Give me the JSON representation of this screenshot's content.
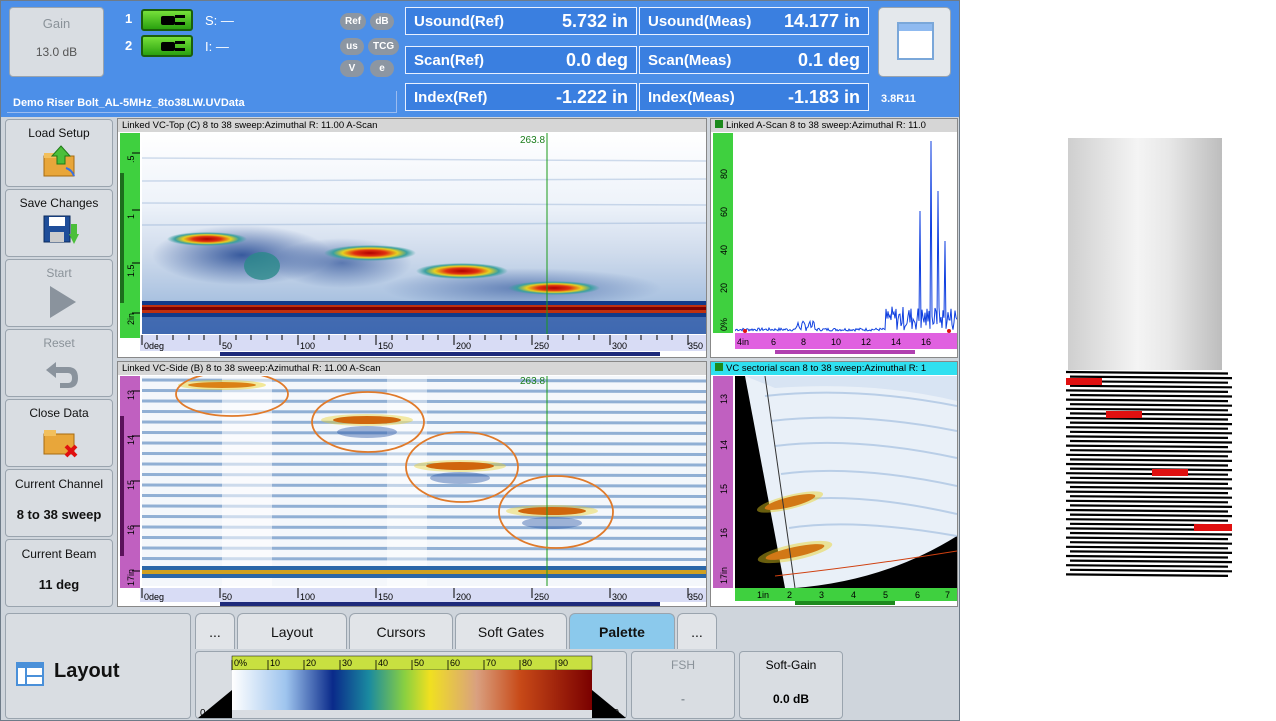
{
  "header": {
    "gain_label": "Gain",
    "gain_value": "13.0 dB",
    "channel1": "1",
    "channel2": "2",
    "s_label": "S: —",
    "i_label": "I: —",
    "pills": [
      "Ref",
      "dB",
      "us",
      "TCG",
      "V",
      "e"
    ],
    "file_name": "Demo Riser Bolt_AL-5MHz_8to38LW.UVData",
    "version": "3.8R11",
    "readings": [
      {
        "label": "Usound(Ref)",
        "value": "5.732 in"
      },
      {
        "label": "Usound(Meas)",
        "value": "14.177 in"
      },
      {
        "label": "Scan(Ref)",
        "value": "0.0 deg"
      },
      {
        "label": "Scan(Meas)",
        "value": "0.1 deg"
      },
      {
        "label": "Index(Ref)",
        "value": "-1.222 in"
      },
      {
        "label": "Index(Meas)",
        "value": "-1.183 in"
      }
    ]
  },
  "sidebar": {
    "load_setup": "Load Setup",
    "save_changes": "Save Changes",
    "start": "Start",
    "reset": "Reset",
    "close_data": "Close Data",
    "current_channel_label": "Current Channel",
    "current_channel_value": "8 to 38 sweep",
    "current_beam_label": "Current Beam",
    "current_beam_value": "11 deg"
  },
  "panels": {
    "ctop_title": "Linked VC-Top (C) 8 to 38 sweep:Azimuthal   R: 11.00 A-Scan",
    "bside_title": "Linked VC-Side (B) 8 to 38 sweep:Azimuthal   R: 11.00 A-Scan",
    "ascan_title": "Linked A-Scan 8 to 38 sweep:Azimuthal   R: 11.0",
    "sector_title": "VC sectorial scan 8 to 38 sweep:Azimuthal   R: 1",
    "cursor_value": "263.8",
    "ctop_yticks": [
      ".5",
      "1",
      "1.5",
      "2in"
    ],
    "bside_yticks": [
      "13",
      "14",
      "15",
      "16",
      "17in"
    ],
    "deg_ticks": [
      "0deg",
      "50",
      "100",
      "150",
      "200",
      "250",
      "300",
      "350"
    ],
    "ascan_yticks": [
      "0%",
      "20",
      "40",
      "60",
      "80"
    ],
    "ascan_xticks": [
      "4in",
      "6",
      "8",
      "10",
      "12",
      "14",
      "16"
    ],
    "sector_yticks": [
      "13",
      "14",
      "15",
      "16",
      "17in"
    ],
    "sector_xticks": [
      "1in",
      "2",
      "3",
      "4",
      "5",
      "6",
      "7"
    ]
  },
  "bottom": {
    "layout_label": "Layout",
    "tabs": [
      "...",
      "Layout",
      "Cursors",
      "Soft Gates",
      "Palette",
      "..."
    ],
    "active_tab": "Palette",
    "palette_ticks": [
      "0%",
      "10",
      "20",
      "30",
      "40",
      "50",
      "60",
      "70",
      "80",
      "90"
    ],
    "palette_min": "0.0",
    "palette_max": "100.0",
    "fsh_label": "FSH",
    "fsh_value": "-",
    "softgain_label": "Soft-Gain",
    "softgain_value": "0.0 dB"
  },
  "colors": {
    "header_blue": "#4c8fe8",
    "accent_green": "#3fd03f",
    "accent_magenta": "#e060e0",
    "annotation_orange": "#e07a2a",
    "flaw_red": "#e01010"
  },
  "icons": [
    "load-setup-icon",
    "save-icon",
    "play-icon",
    "reset-icon",
    "close-folder-icon",
    "window-icon",
    "layout-icon",
    "plug-icon"
  ]
}
